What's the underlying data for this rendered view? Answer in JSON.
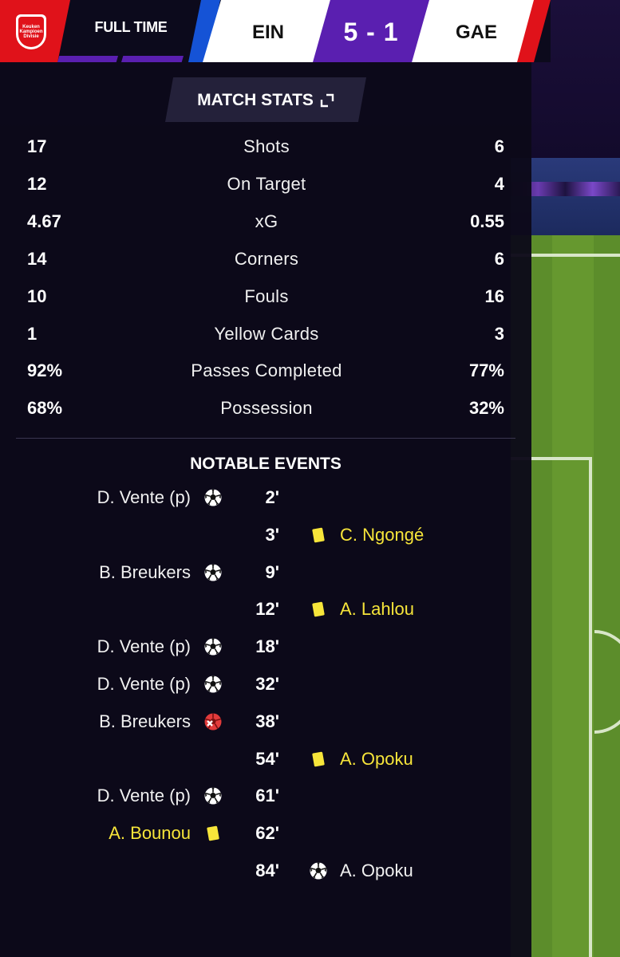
{
  "header": {
    "competition_logo_text": "Keuken\nKampioen\nDivisie",
    "status": "FULL TIME",
    "home_team": "EIN",
    "score": "5 - 1",
    "away_team": "GAE",
    "colors": {
      "home_accent": "#1553d6",
      "away_accent": "#e0121a",
      "score_bg": "#5a1fb0",
      "logo_bg": "#e0121a"
    }
  },
  "match_stats": {
    "title": "MATCH STATS",
    "title_icon": "expand-icon",
    "rows": [
      {
        "label": "Shots",
        "home": "17",
        "away": "6"
      },
      {
        "label": "On Target",
        "home": "12",
        "away": "4"
      },
      {
        "label": "xG",
        "home": "4.67",
        "away": "0.55"
      },
      {
        "label": "Corners",
        "home": "14",
        "away": "6"
      },
      {
        "label": "Fouls",
        "home": "10",
        "away": "16"
      },
      {
        "label": "Yellow Cards",
        "home": "1",
        "away": "3"
      },
      {
        "label": "Passes Completed",
        "home": "92%",
        "away": "77%"
      },
      {
        "label": "Possession",
        "home": "68%",
        "away": "32%"
      }
    ]
  },
  "notable_events": {
    "title": "NOTABLE EVENTS",
    "events": [
      {
        "minute": "2'",
        "side": "home",
        "player": "D. Vente (p)",
        "icon": "goal-icon"
      },
      {
        "minute": "3'",
        "side": "away",
        "player": "C. Ngongé",
        "icon": "yellow-card-icon"
      },
      {
        "minute": "9'",
        "side": "home",
        "player": "B. Breukers",
        "icon": "goal-icon"
      },
      {
        "minute": "12'",
        "side": "away",
        "player": "A. Lahlou",
        "icon": "yellow-card-icon"
      },
      {
        "minute": "18'",
        "side": "home",
        "player": "D. Vente (p)",
        "icon": "goal-icon"
      },
      {
        "minute": "32'",
        "side": "home",
        "player": "D. Vente (p)",
        "icon": "goal-icon"
      },
      {
        "minute": "38'",
        "side": "home",
        "player": "B. Breukers",
        "icon": "injury-icon"
      },
      {
        "minute": "54'",
        "side": "away",
        "player": "A. Opoku",
        "icon": "yellow-card-icon"
      },
      {
        "minute": "61'",
        "side": "home",
        "player": "D. Vente (p)",
        "icon": "goal-icon"
      },
      {
        "minute": "62'",
        "side": "home",
        "player": "A. Bounou",
        "icon": "yellow-card-icon"
      },
      {
        "minute": "84'",
        "side": "away",
        "player": "A. Opoku",
        "icon": "goal-icon"
      }
    ]
  }
}
